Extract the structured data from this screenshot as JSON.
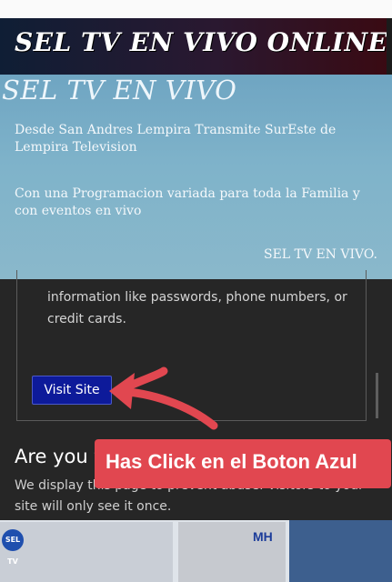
{
  "title_bar": {
    "title": "SEL TV EN VIVO ONLINE"
  },
  "hero": {
    "heading": "SEL TV EN VIVO",
    "paragraph1": "Desde San Andres Lempira Transmite SurEste de Lempira Television",
    "paragraph2": "Con una Programacion variada para toda la Familia y con eventos en vivo",
    "footer": "SEL TV EN VIVO."
  },
  "warning_page": {
    "info_text": "information like passwords, phone numbers, or credit cards.",
    "visit_button": "Visit Site",
    "heading": "Are you the developer?",
    "body": "We display this page to prevent abuse. Visitors to your site will only see it once."
  },
  "annotation": {
    "banner_text": "Has Click en el Boton Azul",
    "arrow_color": "#e14750"
  },
  "bottom_strip": {
    "left_logo": "SEL TV",
    "right_logo": "MH"
  }
}
